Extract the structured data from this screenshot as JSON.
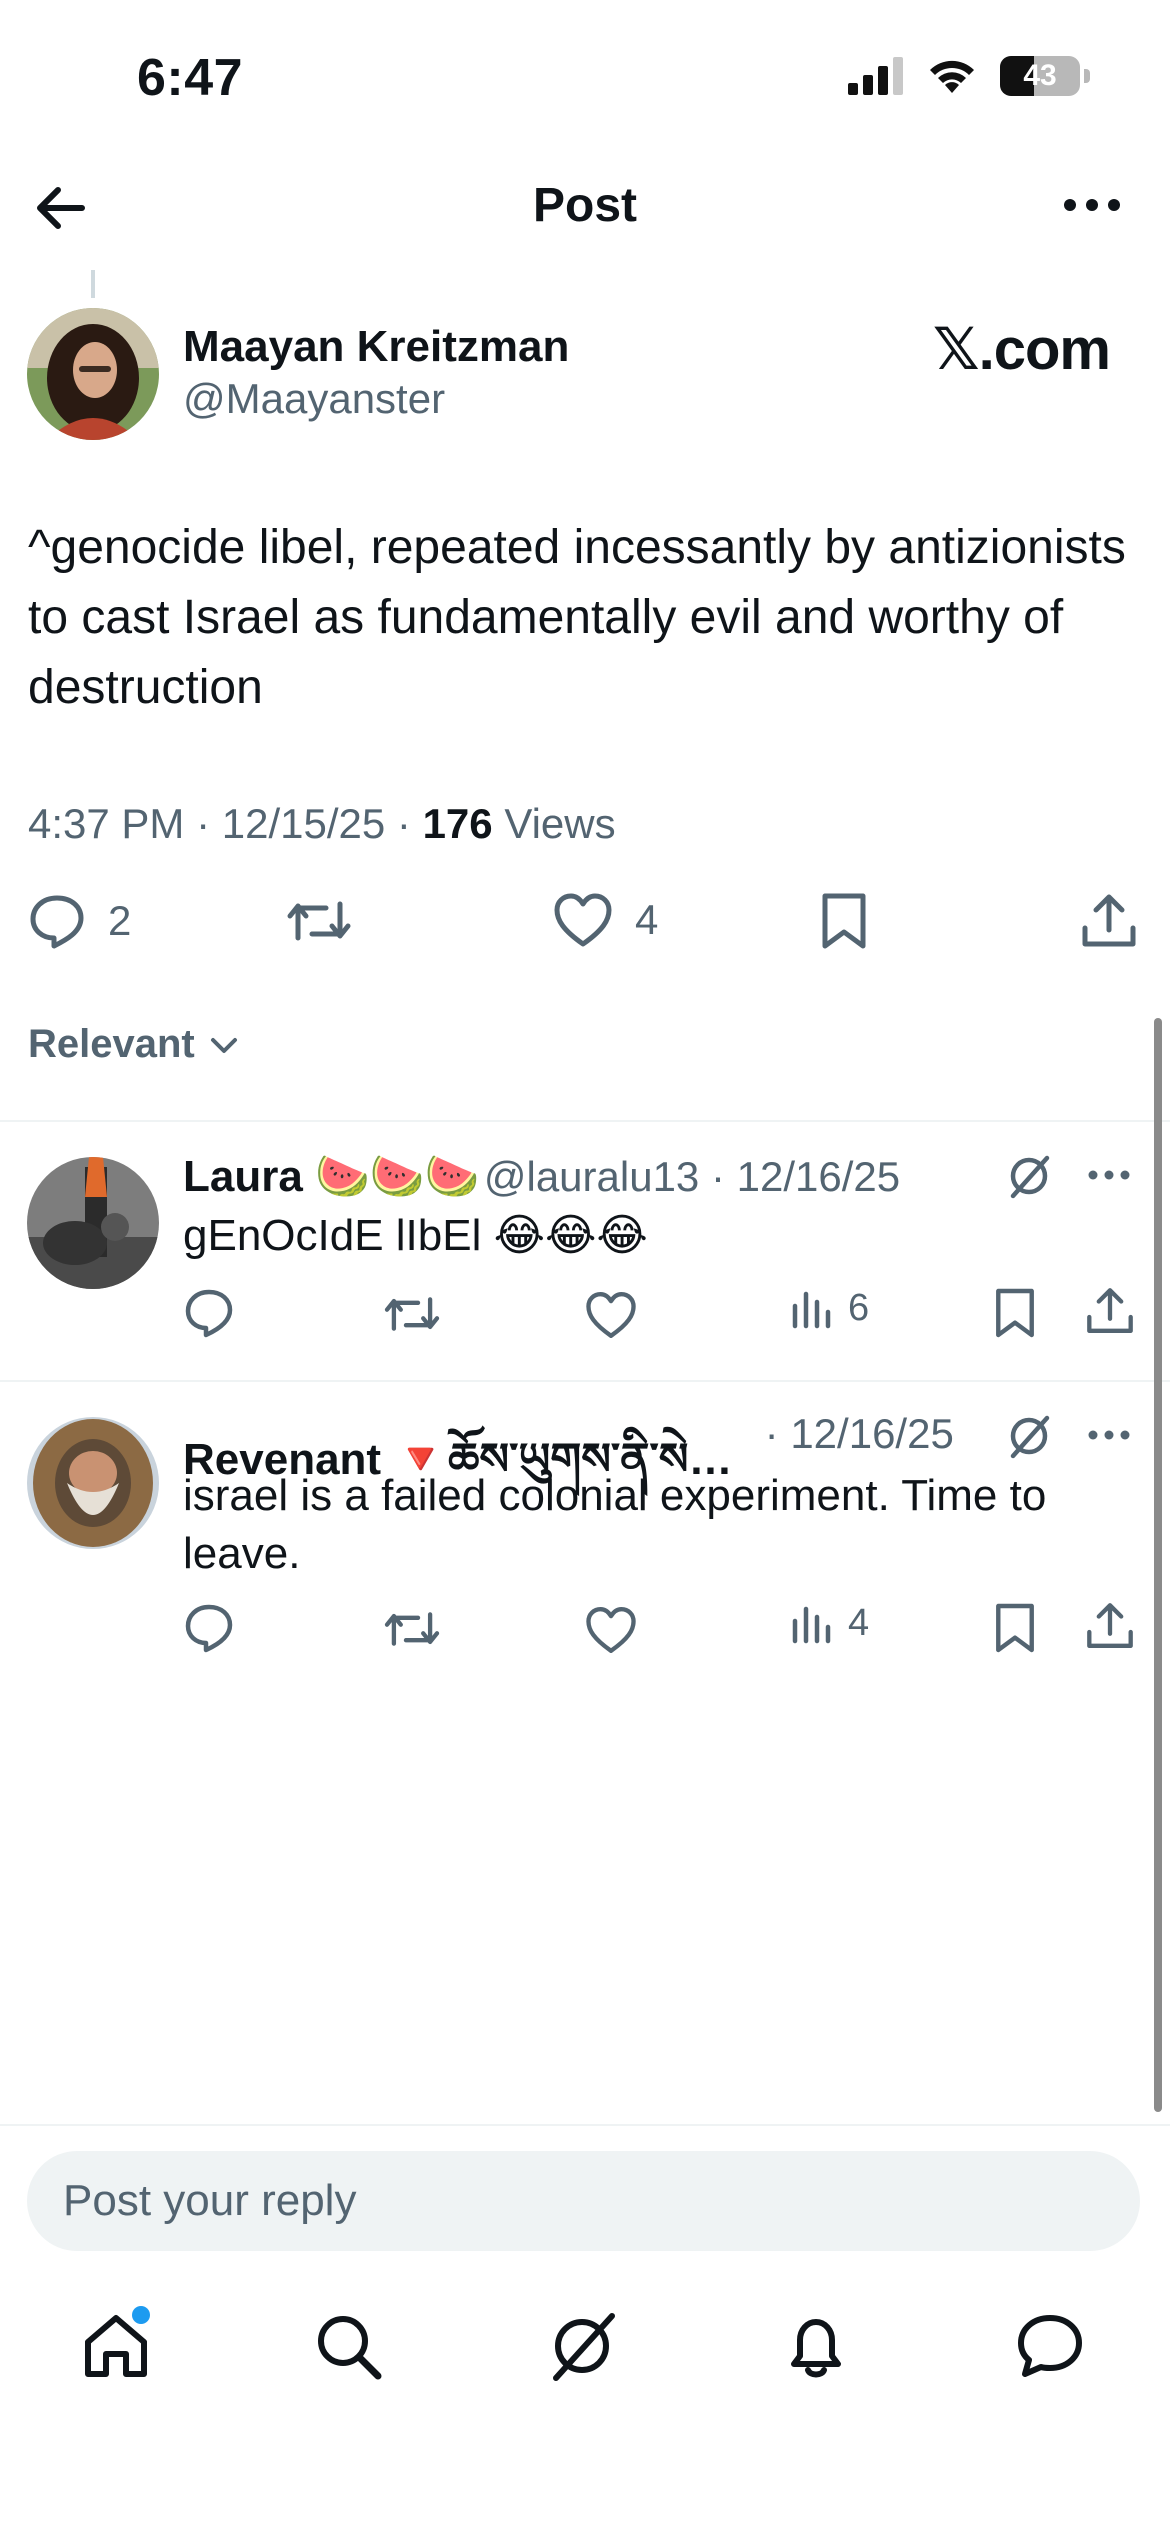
{
  "status_bar": {
    "time": "6:47",
    "battery_level": "43"
  },
  "nav": {
    "title": "Post",
    "back_icon": "arrow-left-icon",
    "more_icon": "more-horizontal-icon"
  },
  "post": {
    "author_name": "Maayan Kreitzman",
    "author_handle": "@Maayanster",
    "watermark": "𝕏.com",
    "text": "^genocide libel, repeated incessantly by antizionists to cast Israel as fundamentally evil and worthy of destruction",
    "time": "4:37 PM",
    "date": "12/15/25",
    "views_count": "176",
    "views_label": "Views",
    "replies_count": "2",
    "likes_count": "4"
  },
  "sort": {
    "label": "Relevant"
  },
  "replies": [
    {
      "name": "Laura 🍉🍉🍉",
      "handle": "@lauralu13",
      "date": "12/16/25",
      "text": "gEnOcIdE lIbEl 😂😂😂",
      "views": "6"
    },
    {
      "name": "Revenant 🔻ཆོས་ཡུགས་ནི་སེམས་ཁམ...",
      "handle": "",
      "date": "12/16/25",
      "text": "israel is a failed colonial experiment. Time to leave.",
      "views": "4"
    }
  ],
  "composer": {
    "placeholder": "Post your reply"
  },
  "tabs": [
    "home-icon",
    "search-icon",
    "grok-icon",
    "notifications-icon",
    "messages-icon"
  ],
  "colors": {
    "accent": "#1d9bf0",
    "secondary_text": "#536471",
    "primary_text": "#0f1419"
  }
}
